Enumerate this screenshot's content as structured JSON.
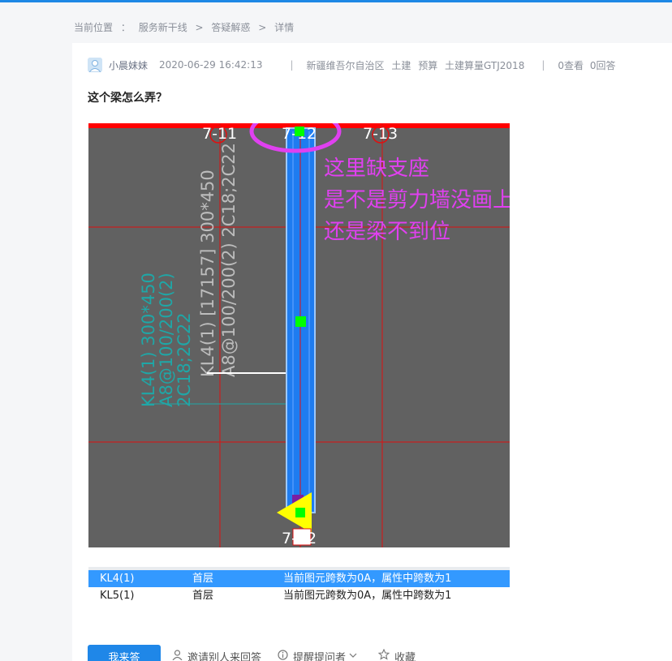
{
  "breadcrumb": {
    "prefix": "当前位置",
    "colon": "：",
    "items": [
      "服务新干线",
      "答疑解惑",
      "详情"
    ],
    "sep": ">"
  },
  "post": {
    "author": "小晨妹妹",
    "time": "2020-06-29 16:42:13",
    "divider": "|",
    "tags": [
      "新疆维吾尔自治区",
      "土建",
      "预算",
      "土建算量GTJ2018"
    ],
    "views": "0查看",
    "answers": "0回答",
    "title": "这个梁怎么弄？"
  },
  "drawing": {
    "labels": {
      "axis_left": "7-11",
      "axis_mid": "7-12",
      "axis_right": "7-13",
      "axis_bottom": "7-12"
    },
    "beam_text_1": "KL4(1) [17157] 300*450",
    "beam_text_2": "A8@100/200(2) 2C18;2C22",
    "ghost_text_1": "KL4(1) 300*450",
    "ghost_text_2": "A8@100/200(2)",
    "ghost_text_3": "2C18;2C22",
    "annotation": [
      "这里缺支座",
      "是不是剪力墙没画上",
      "还是梁不到位"
    ],
    "colors": {
      "background": "#616161",
      "beam": "#1e7cf0",
      "grid": "#e01010",
      "marker": "#00ff00",
      "annotation": "#e040f0",
      "axis_text": "#ffffff"
    }
  },
  "table": {
    "rows": [
      {
        "name": "KL4(1)",
        "floor": "首层",
        "desc": "当前图元跨数为0A，属性中跨数为1",
        "selected": true
      },
      {
        "name": "KL5(1)",
        "floor": "首层",
        "desc": "当前图元跨数为0A，属性中跨数为1",
        "selected": false
      }
    ]
  },
  "actions": {
    "answer": "我来答",
    "invite": "邀请别人来回答",
    "remind": "提醒提问者",
    "favorite": "收藏"
  }
}
